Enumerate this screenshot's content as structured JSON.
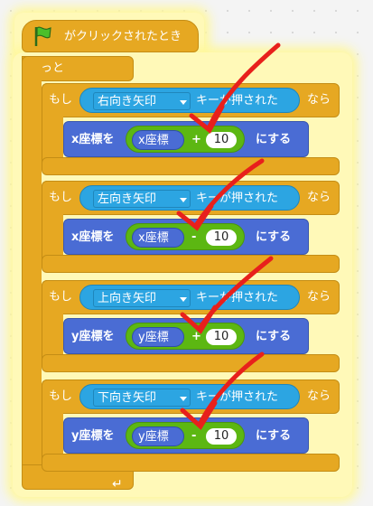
{
  "hat": {
    "label": "がクリックされたとき",
    "flag_icon": "green-flag-icon",
    "color": "#e6a822"
  },
  "forever": {
    "label": "ずっと",
    "loop_icon": "loop-arrow-icon"
  },
  "if_blocks": [
    {
      "if_label": "もし",
      "key": "右向き矢印",
      "key_suffix": "キーが押された",
      "then_label": "なら",
      "set_prefix": "x座標を",
      "var": "x座標",
      "op": "+",
      "value": "10",
      "set_suffix": "にする"
    },
    {
      "if_label": "もし",
      "key": "左向き矢印",
      "key_suffix": "キーが押された",
      "then_label": "なら",
      "set_prefix": "x座標を",
      "var": "x座標",
      "op": "-",
      "value": "10",
      "set_suffix": "にする"
    },
    {
      "if_label": "もし",
      "key": "上向き矢印",
      "key_suffix": "キーが押された",
      "then_label": "なら",
      "set_prefix": "y座標を",
      "var": "y座標",
      "op": "+",
      "value": "10",
      "set_suffix": "にする"
    },
    {
      "if_label": "もし",
      "key": "下向き矢印",
      "key_suffix": "キーが押された",
      "then_label": "なら",
      "set_prefix": "y座標を",
      "var": "y座標",
      "op": "-",
      "value": "10",
      "set_suffix": "にする"
    }
  ],
  "colors": {
    "control": "#e6a822",
    "motion": "#4a6cd4",
    "sensing": "#2ca5e2",
    "operator": "#5cb712",
    "annotation": "#e8201c"
  }
}
